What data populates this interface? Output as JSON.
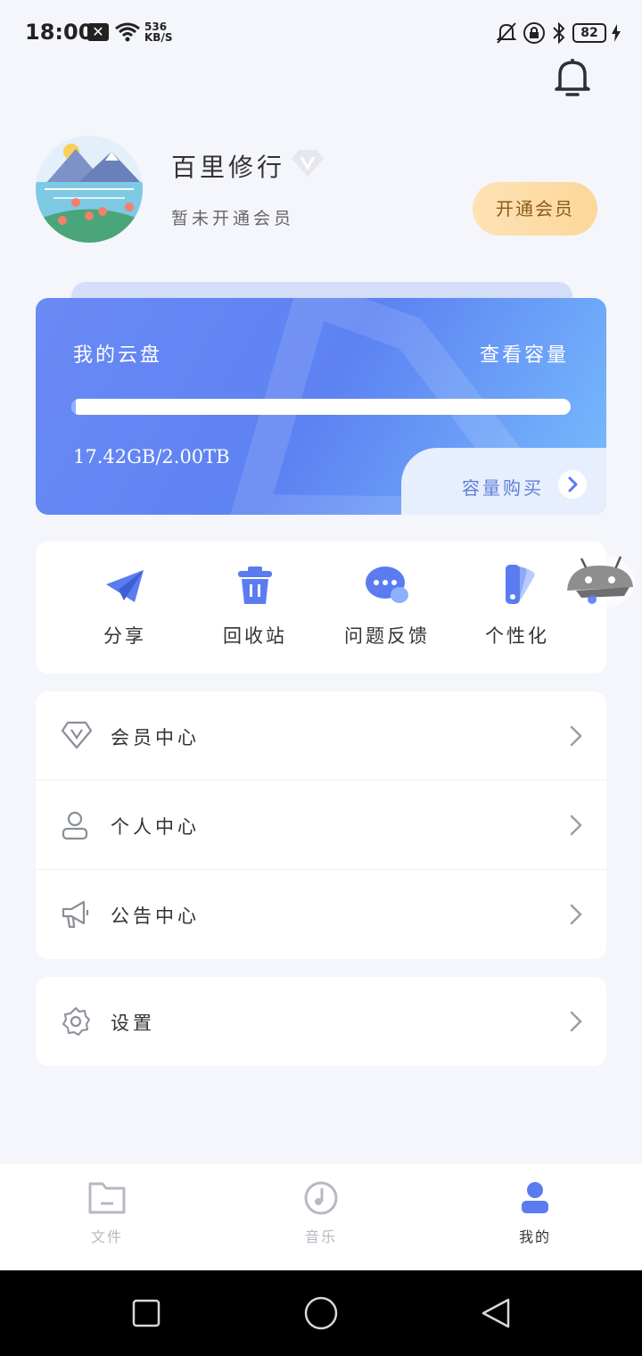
{
  "status_bar": {
    "time": "18:00",
    "network_speed_value": "536",
    "network_speed_unit": "KB/S",
    "battery": "82"
  },
  "profile": {
    "username": "百里修行",
    "member_status": "暂未开通会员",
    "open_vip_label": "开通会员"
  },
  "storage": {
    "title": "我的云盘",
    "view_capacity": "查看容量",
    "usage": "17.42GB/2.00TB",
    "used_fraction": 0.0085,
    "buy_label": "容量购买"
  },
  "quick_actions": [
    {
      "label": "分享",
      "icon": "paper-plane-icon"
    },
    {
      "label": "回收站",
      "icon": "trash-icon"
    },
    {
      "label": "问题反馈",
      "icon": "chat-bubble-icon"
    },
    {
      "label": "个性化",
      "icon": "swatch-icon"
    }
  ],
  "menu": [
    {
      "label": "会员中心",
      "icon": "vip-diamond-icon"
    },
    {
      "label": "个人中心",
      "icon": "person-icon"
    },
    {
      "label": "公告中心",
      "icon": "megaphone-icon"
    }
  ],
  "settings": {
    "label": "设置",
    "icon": "gear-icon"
  },
  "bottom_nav": [
    {
      "label": "文件",
      "icon": "folder-icon",
      "active": false
    },
    {
      "label": "音乐",
      "icon": "music-disc-icon",
      "active": false
    },
    {
      "label": "我的",
      "icon": "person-icon",
      "active": true
    }
  ],
  "colors": {
    "accent": "#5b7cf0",
    "background": "#f4f6fb",
    "vip_button": "#fdd79b",
    "inactive_nav": "#b5b9c2"
  }
}
